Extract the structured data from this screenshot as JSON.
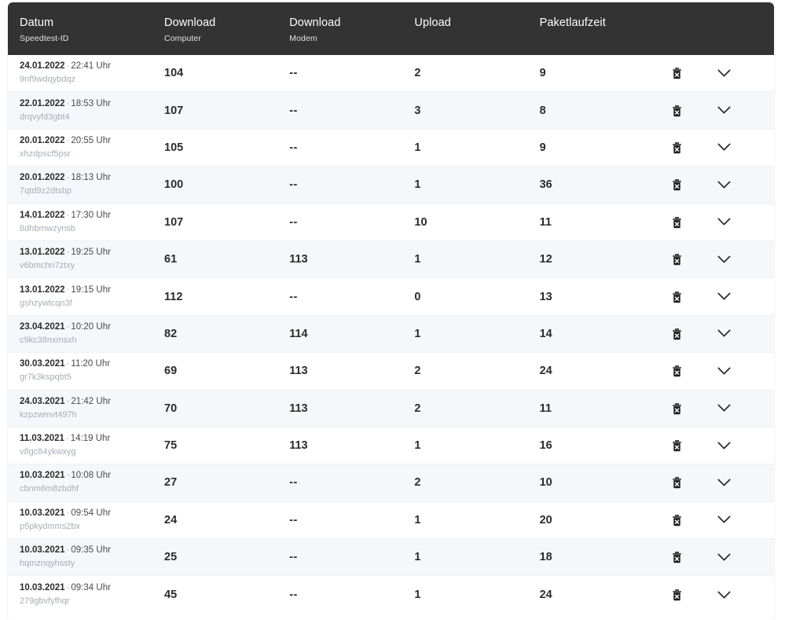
{
  "table": {
    "columns": [
      {
        "key": "date",
        "main": "Datum",
        "sub": "Speedtest-ID"
      },
      {
        "key": "dlcomp",
        "main": "Download",
        "sub": "Computer"
      },
      {
        "key": "dlmod",
        "main": "Download",
        "sub": "Modem"
      },
      {
        "key": "upload",
        "main": "Upload",
        "sub": ""
      },
      {
        "key": "packet",
        "main": "Paketlaufzeit",
        "sub": ""
      }
    ],
    "time_suffix": "Uhr",
    "separator": "·",
    "empty_value": "--",
    "actions": {
      "delete_icon": "trash-delete-icon",
      "expand_icon": "chevron-down-icon"
    },
    "rows": [
      {
        "date": "24.01.2022",
        "time": "22:41",
        "id": "9nf9wdqybdqz",
        "download_computer": "104",
        "download_modem": "--",
        "upload": "2",
        "paketlaufzeit": "9"
      },
      {
        "date": "22.01.2022",
        "time": "18:53",
        "id": "drqvyfd3gbt4",
        "download_computer": "107",
        "download_modem": "--",
        "upload": "3",
        "paketlaufzeit": "8"
      },
      {
        "date": "20.01.2022",
        "time": "20:55",
        "id": "xhzdpscf5psr",
        "download_computer": "105",
        "download_modem": "--",
        "upload": "1",
        "paketlaufzeit": "9"
      },
      {
        "date": "20.01.2022",
        "time": "18:13",
        "id": "7qtd9z2dtsbp",
        "download_computer": "100",
        "download_modem": "--",
        "upload": "1",
        "paketlaufzeit": "36"
      },
      {
        "date": "14.01.2022",
        "time": "17:30",
        "id": "8dhbrnwzynsb",
        "download_computer": "107",
        "download_modem": "--",
        "upload": "10",
        "paketlaufzeit": "11"
      },
      {
        "date": "13.01.2022",
        "time": "19:25",
        "id": "v6bmchn7ztxy",
        "download_computer": "61",
        "download_modem": "113",
        "upload": "1",
        "paketlaufzeit": "12"
      },
      {
        "date": "13.01.2022",
        "time": "19:15",
        "id": "gshzywtcqn3f",
        "download_computer": "112",
        "download_modem": "--",
        "upload": "0",
        "paketlaufzeit": "13"
      },
      {
        "date": "23.04.2021",
        "time": "10:20",
        "id": "c9kc38nxmsxh",
        "download_computer": "82",
        "download_modem": "114",
        "upload": "1",
        "paketlaufzeit": "14"
      },
      {
        "date": "30.03.2021",
        "time": "11:20",
        "id": "gr7k3kspqbt5",
        "download_computer": "69",
        "download_modem": "113",
        "upload": "2",
        "paketlaufzeit": "24"
      },
      {
        "date": "24.03.2021",
        "time": "21:42",
        "id": "kzpzwmvt497h",
        "download_computer": "70",
        "download_modem": "113",
        "upload": "2",
        "paketlaufzeit": "11"
      },
      {
        "date": "11.03.2021",
        "time": "14:19",
        "id": "v8gc84ykwxyg",
        "download_computer": "75",
        "download_modem": "113",
        "upload": "1",
        "paketlaufzeit": "16"
      },
      {
        "date": "10.03.2021",
        "time": "10:08",
        "id": "cbnm6m8zbdhf",
        "download_computer": "27",
        "download_modem": "--",
        "upload": "2",
        "paketlaufzeit": "10"
      },
      {
        "date": "10.03.2021",
        "time": "09:54",
        "id": "p5pkydmms2bx",
        "download_computer": "24",
        "download_modem": "--",
        "upload": "1",
        "paketlaufzeit": "20"
      },
      {
        "date": "10.03.2021",
        "time": "09:35",
        "id": "hqmznqyhssty",
        "download_computer": "25",
        "download_modem": "--",
        "upload": "1",
        "paketlaufzeit": "18"
      },
      {
        "date": "10.03.2021",
        "time": "09:34",
        "id": "279gbvfyfhqr",
        "download_computer": "45",
        "download_modem": "--",
        "upload": "1",
        "paketlaufzeit": "24"
      }
    ]
  },
  "colors": {
    "header_background": "#333333",
    "header_text": "#ffffff",
    "row_background": "#ffffff",
    "row_background_alt": "#f6f7fb",
    "value_text": "#2b2b2b",
    "muted_text": "#a7adb5",
    "page_background": "#ffffff"
  }
}
